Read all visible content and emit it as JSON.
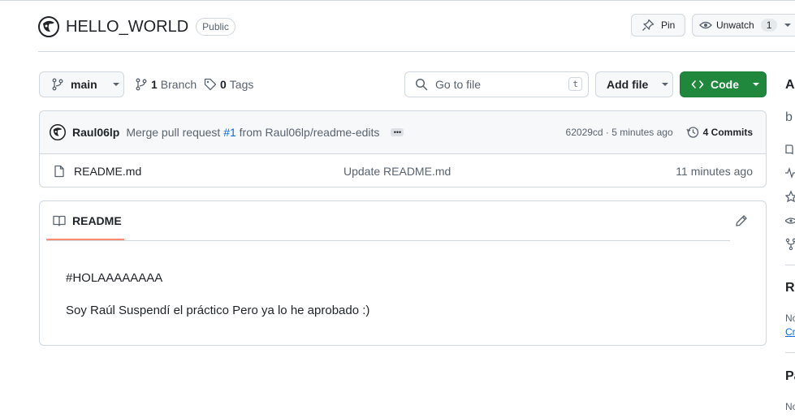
{
  "repo": {
    "name": "HELLO_WORLD",
    "visibility": "Public"
  },
  "actions": {
    "pin_label": "Pin",
    "unwatch_label": "Unwatch",
    "unwatch_count": "1"
  },
  "toolbar": {
    "branch_label": "main",
    "branches_count": "1",
    "branches_label": "Branch",
    "tags_count": "0",
    "tags_label": "Tags",
    "search_placeholder": "Go to file",
    "search_shortcut": "t",
    "add_file_label": "Add file",
    "code_label": "Code"
  },
  "latest_commit": {
    "author": "Raul06lp",
    "message_prefix": "Merge pull request",
    "pr_ref": "#1",
    "message_suffix": "from Raul06lp/readme-edits",
    "hash_time": "62029cd · 5 minutes ago",
    "commits_label": "4 Commits"
  },
  "files": [
    {
      "name": "README.md",
      "message": "Update README.md",
      "time": "11 minutes ago"
    }
  ],
  "readme": {
    "tab_label": "README",
    "heading": "#HOLAAAAAAAA",
    "body": "Soy Raúl Suspendí el práctico Pero ya lo he aprobado :)"
  },
  "sidebar": {
    "about_initial": "A",
    "desc_initial": "b",
    "releases_initial": "Re",
    "releases_text_initial": "No",
    "releases_link_initial": "Cr",
    "packages_initial": "Pa",
    "packages_text_initial": "No"
  },
  "colors": {
    "accent_green": "#1f883d",
    "link_blue": "#0969da",
    "tab_underline": "#fd8c73",
    "border": "#d0d7de"
  }
}
